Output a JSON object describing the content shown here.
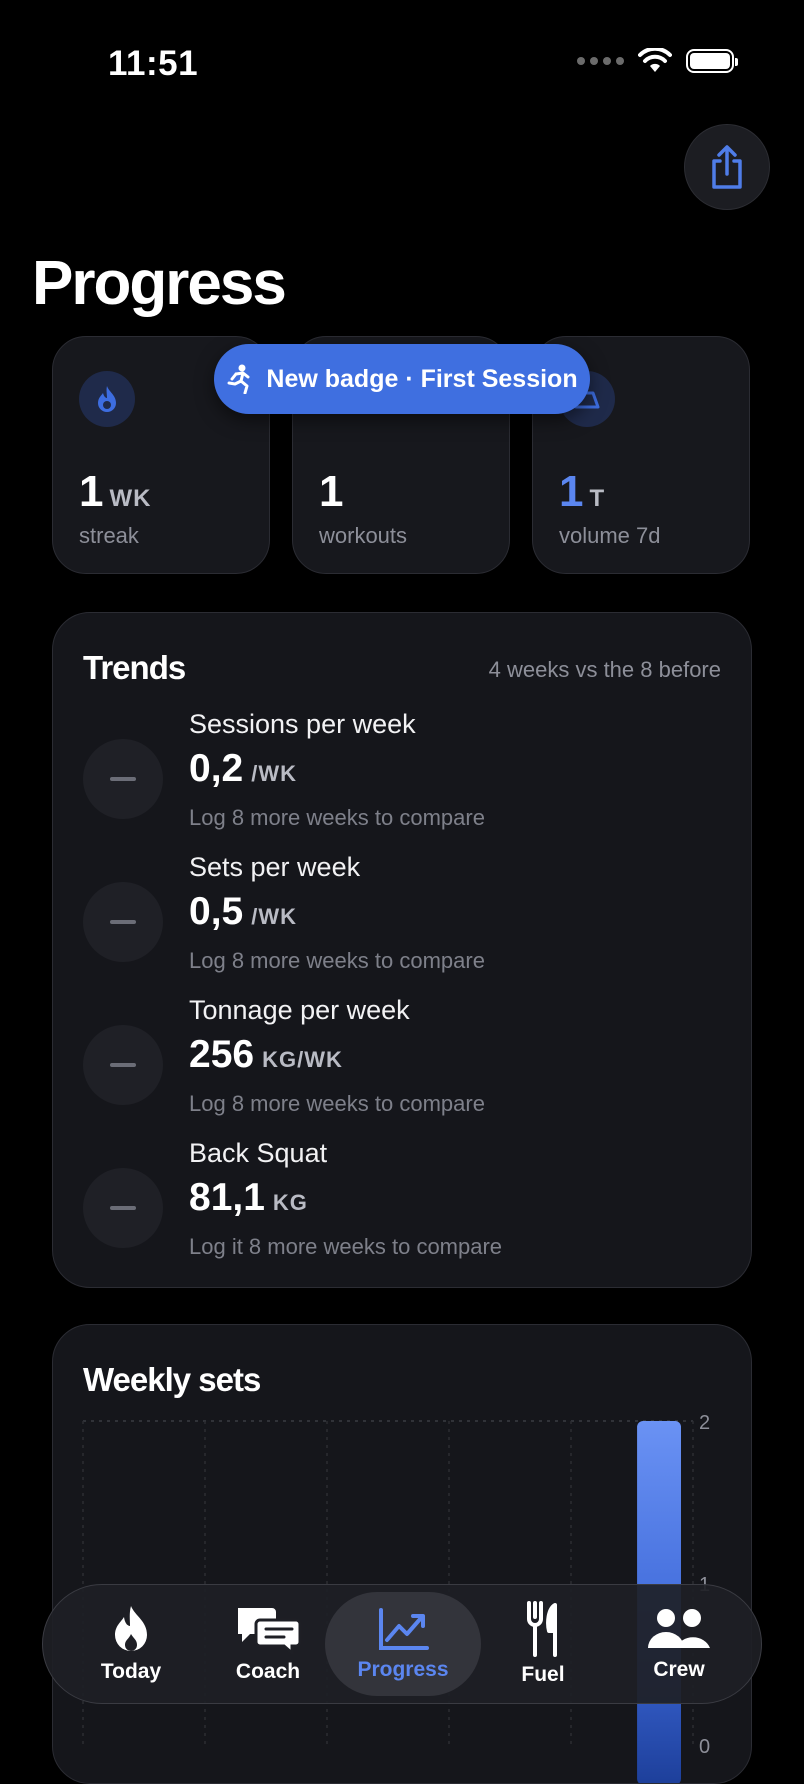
{
  "status_bar": {
    "time": "11:51"
  },
  "header": {
    "title": "Progress"
  },
  "toast": {
    "text": "New badge · First Session"
  },
  "stats": [
    {
      "value": "1",
      "unit": "WK",
      "label": "streak"
    },
    {
      "value": "1",
      "unit": "",
      "label": "workouts"
    },
    {
      "value": "1",
      "unit": "T",
      "label": "volume 7d"
    }
  ],
  "trends": {
    "title": "Trends",
    "subtitle": "4 weeks vs the 8 before",
    "rows": [
      {
        "name": "Sessions per week",
        "value": "0,2",
        "unit": "/WK",
        "note": "Log 8 more weeks to compare"
      },
      {
        "name": "Sets per week",
        "value": "0,5",
        "unit": "/WK",
        "note": "Log 8 more weeks to compare"
      },
      {
        "name": "Tonnage per week",
        "value": "256",
        "unit": "KG/WK",
        "note": "Log 8 more weeks to compare"
      },
      {
        "name": "Back Squat",
        "value": "81,1",
        "unit": "KG",
        "note": "Log it 8 more weeks to compare"
      }
    ]
  },
  "weekly_sets": {
    "title": "Weekly sets",
    "chart_data": {
      "type": "bar",
      "categories": [
        "",
        "",
        "",
        "",
        ""
      ],
      "values": [
        0,
        0,
        0,
        0,
        2
      ],
      "ylim": [
        0,
        2
      ],
      "yticks": [
        "2",
        "1",
        "0"
      ],
      "grid": true,
      "bar_color": "#5b86f0"
    }
  },
  "tabs": [
    {
      "label": "Today",
      "icon": "flame-icon",
      "active": false
    },
    {
      "label": "Coach",
      "icon": "chat-icon",
      "active": false
    },
    {
      "label": "Progress",
      "icon": "chart-icon",
      "active": true
    },
    {
      "label": "Fuel",
      "icon": "fork-knife-icon",
      "active": false
    },
    {
      "label": "Crew",
      "icon": "people-icon",
      "active": false
    }
  ],
  "colors": {
    "accent": "#5b86f0",
    "toast": "#3f6fe0",
    "card": "#15161b"
  }
}
